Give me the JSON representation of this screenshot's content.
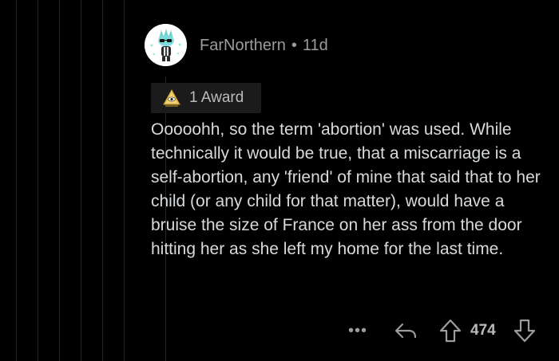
{
  "comment": {
    "author": "FarNorthern",
    "separator": "•",
    "age": "11d",
    "avatar_icon": "snoo-avatar-icon",
    "award": {
      "icon": "award-icon",
      "label": "1 Award"
    },
    "body": "Ooooohh, so the term 'abortion' was used. While technically it would be true, that a miscarriage is a self-abortion, any 'friend' of mine that said that to her child (or any child for that matter), would have a bruise the size of France on her ass from the door hitting her as she left my home for the last time.",
    "actions": {
      "more_label": "•••",
      "reply_icon": "reply-icon",
      "upvote_icon": "upvote-arrow-icon",
      "vote_count": "474",
      "downvote_icon": "downvote-arrow-icon"
    }
  },
  "colors": {
    "background": "#000000",
    "text": "#d7dadc",
    "muted": "#9a9c9e",
    "award_chip": "#1b1b1b",
    "avatar_accent": "#6fd3d3"
  }
}
